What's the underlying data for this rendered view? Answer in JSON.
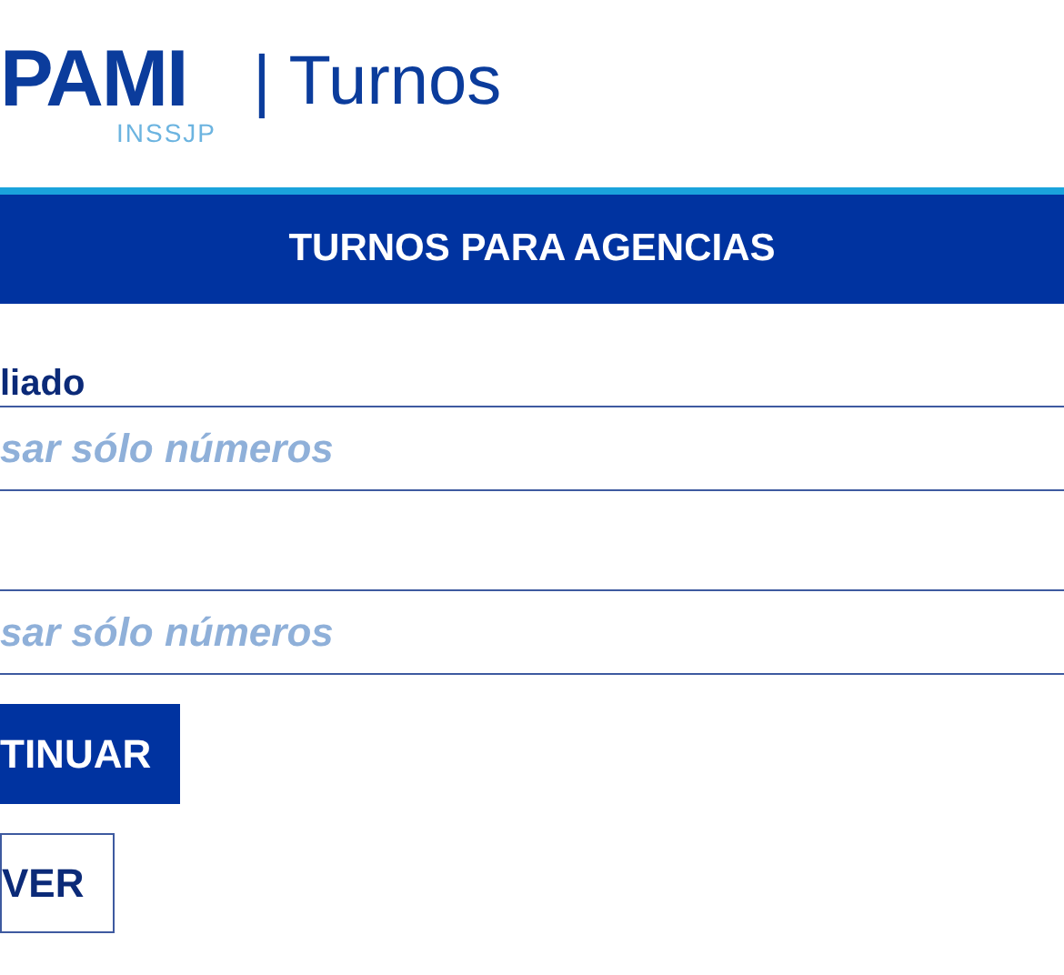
{
  "header": {
    "logo": "PAMI",
    "logo_subtitle": "INSSJP",
    "title": "| Turnos"
  },
  "banner": {
    "title": "TURNOS PARA AGENCIAS"
  },
  "form": {
    "fields": [
      {
        "label": "liado",
        "placeholder": "sar sólo números"
      },
      {
        "placeholder": "sar sólo números"
      }
    ],
    "buttons": [
      {
        "label": "TINUAR",
        "kind": "primary"
      },
      {
        "label": "VER",
        "kind": "outline"
      }
    ]
  }
}
